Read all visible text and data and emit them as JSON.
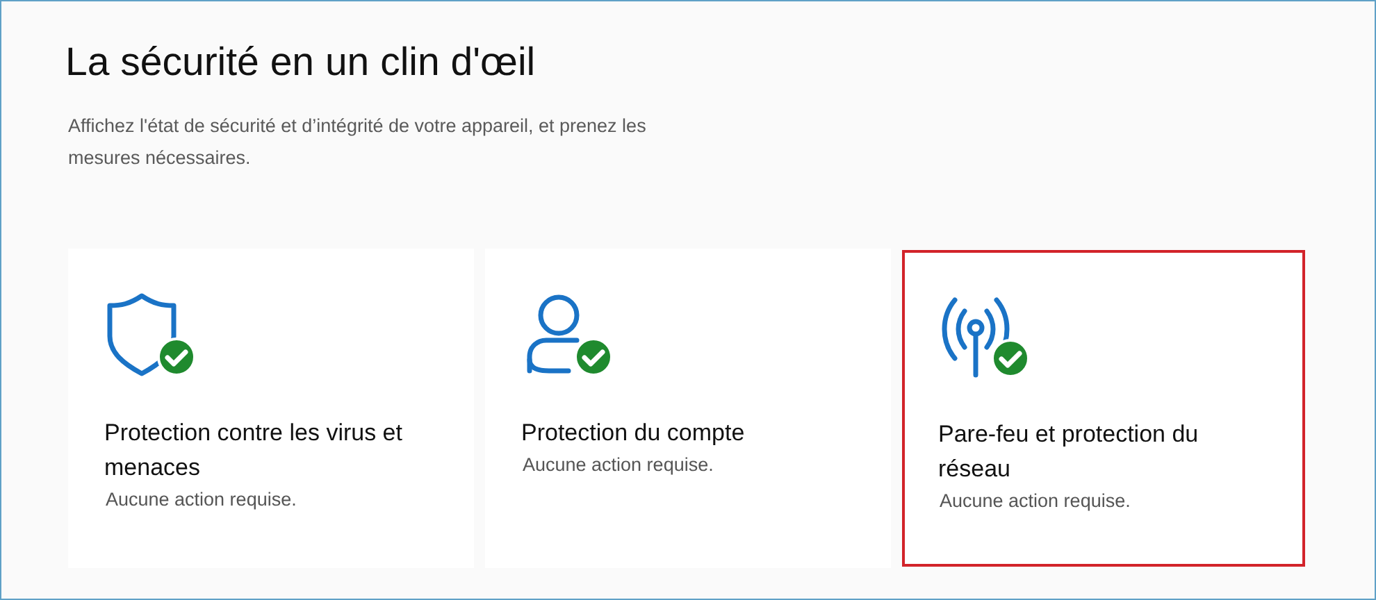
{
  "title": "La sécurité en un clin d'œil",
  "subtitle": "Affichez l'état de sécurité et d’intégrité de votre appareil, et prenez les mesures nécessaires.",
  "cards": [
    {
      "kind": "shield",
      "title": "Protection contre les virus et menaces",
      "detail": "Aucune action requise.",
      "highlighted": false
    },
    {
      "kind": "person",
      "title": "Protection du compte",
      "detail": "Aucune action requise.",
      "highlighted": false
    },
    {
      "kind": "antenna",
      "title": "Pare-feu et protection du réseau",
      "detail": "Aucune action requise.",
      "highlighted": true
    }
  ]
}
